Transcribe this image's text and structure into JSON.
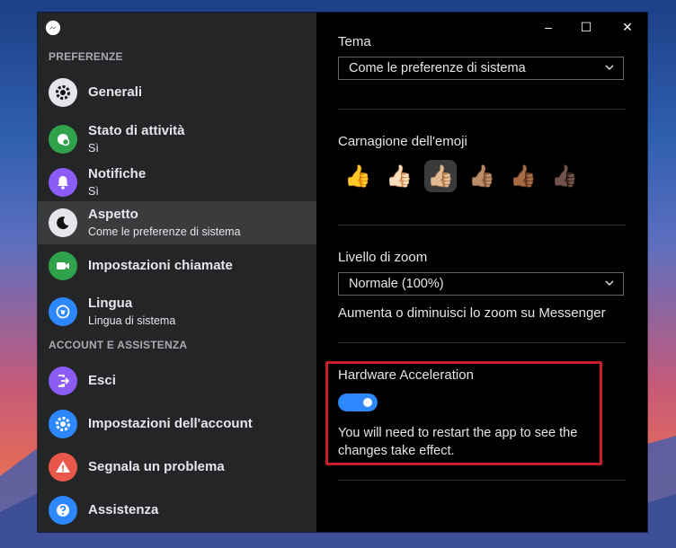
{
  "sidebar": {
    "section_preferences": "PREFERENZE",
    "section_account": "ACCOUNT E ASSISTENZA",
    "items": [
      {
        "label": "Generali",
        "sub": ""
      },
      {
        "label": "Stato di attività",
        "sub": "Sì"
      },
      {
        "label": "Notifiche",
        "sub": "Sì"
      },
      {
        "label": "Aspetto",
        "sub": "Come le preferenze di sistema"
      },
      {
        "label": "Impostazioni chiamate",
        "sub": ""
      },
      {
        "label": "Lingua",
        "sub": "Lingua di sistema"
      },
      {
        "label": "Esci",
        "sub": ""
      },
      {
        "label": "Impostazioni dell'account",
        "sub": ""
      },
      {
        "label": "Segnala un problema",
        "sub": ""
      },
      {
        "label": "Assistenza",
        "sub": ""
      }
    ]
  },
  "window_controls": {
    "minimize": "–",
    "maximize": "☐",
    "close": "✕"
  },
  "content": {
    "theme_label": "Tema",
    "theme_value": "Come le preferenze di sistema",
    "emoji_label": "Carnagione dell'emoji",
    "emojis": [
      "👍",
      "👍🏻",
      "👍🏼",
      "👍🏽",
      "👍🏾",
      "👍🏿"
    ],
    "zoom_label": "Livello di zoom",
    "zoom_value": "Normale (100%)",
    "zoom_desc": "Aumenta o diminuisci lo zoom su Messenger",
    "hw_label": "Hardware Acceleration",
    "hw_enabled": true,
    "hw_note": "You will need to restart the app to see the changes take effect."
  },
  "colors": {
    "accent": "#2d88ff",
    "sidebar_bg": "#242526",
    "active_bg": "#3a3b3c",
    "highlight": "#c7202a"
  }
}
